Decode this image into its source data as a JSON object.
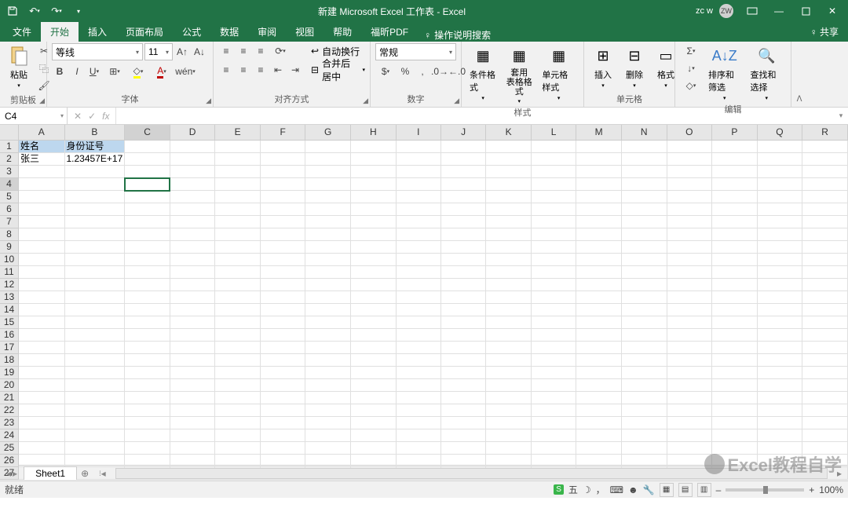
{
  "titlebar": {
    "title": "新建 Microsoft Excel 工作表  -  Excel",
    "user": "zc w",
    "badge": "ZW"
  },
  "tabs": {
    "items": [
      "文件",
      "开始",
      "插入",
      "页面布局",
      "公式",
      "数据",
      "审阅",
      "视图",
      "帮助",
      "福昕PDF"
    ],
    "active": 1,
    "tellme": "操作说明搜索",
    "share": "共享"
  },
  "ribbon": {
    "clipboard": {
      "paste": "粘贴",
      "label": "剪贴板"
    },
    "font": {
      "name": "等线",
      "size": "11",
      "label": "字体"
    },
    "align": {
      "wrap": "自动换行",
      "merge": "合并后居中",
      "label": "对齐方式"
    },
    "number": {
      "format": "常规",
      "label": "数字"
    },
    "styles": {
      "cond": "条件格式",
      "table": "套用\n表格格式",
      "cell": "单元格样式",
      "label": "样式"
    },
    "cells": {
      "insert": "插入",
      "delete": "删除",
      "format": "格式",
      "label": "单元格"
    },
    "editing": {
      "sort": "排序和筛选",
      "find": "查找和选择",
      "label": "编辑"
    }
  },
  "formula": {
    "nameBox": "C4",
    "fx": ""
  },
  "grid": {
    "cols": [
      "A",
      "B",
      "C",
      "D",
      "E",
      "F",
      "G",
      "H",
      "I",
      "J",
      "K",
      "L",
      "M",
      "N",
      "O",
      "P",
      "Q",
      "R"
    ],
    "rows": 27,
    "data": {
      "A1": "姓名",
      "B1": "身份证号",
      "A2": "张三",
      "B2": "1.23457E+17"
    },
    "highlighted_headers": [
      "A1",
      "B1"
    ],
    "selected": "C4"
  },
  "sheets": {
    "active": "Sheet1"
  },
  "status": {
    "ready": "就绪",
    "ime": "五",
    "zoom": "100%"
  },
  "watermark": "Excel教程自学"
}
